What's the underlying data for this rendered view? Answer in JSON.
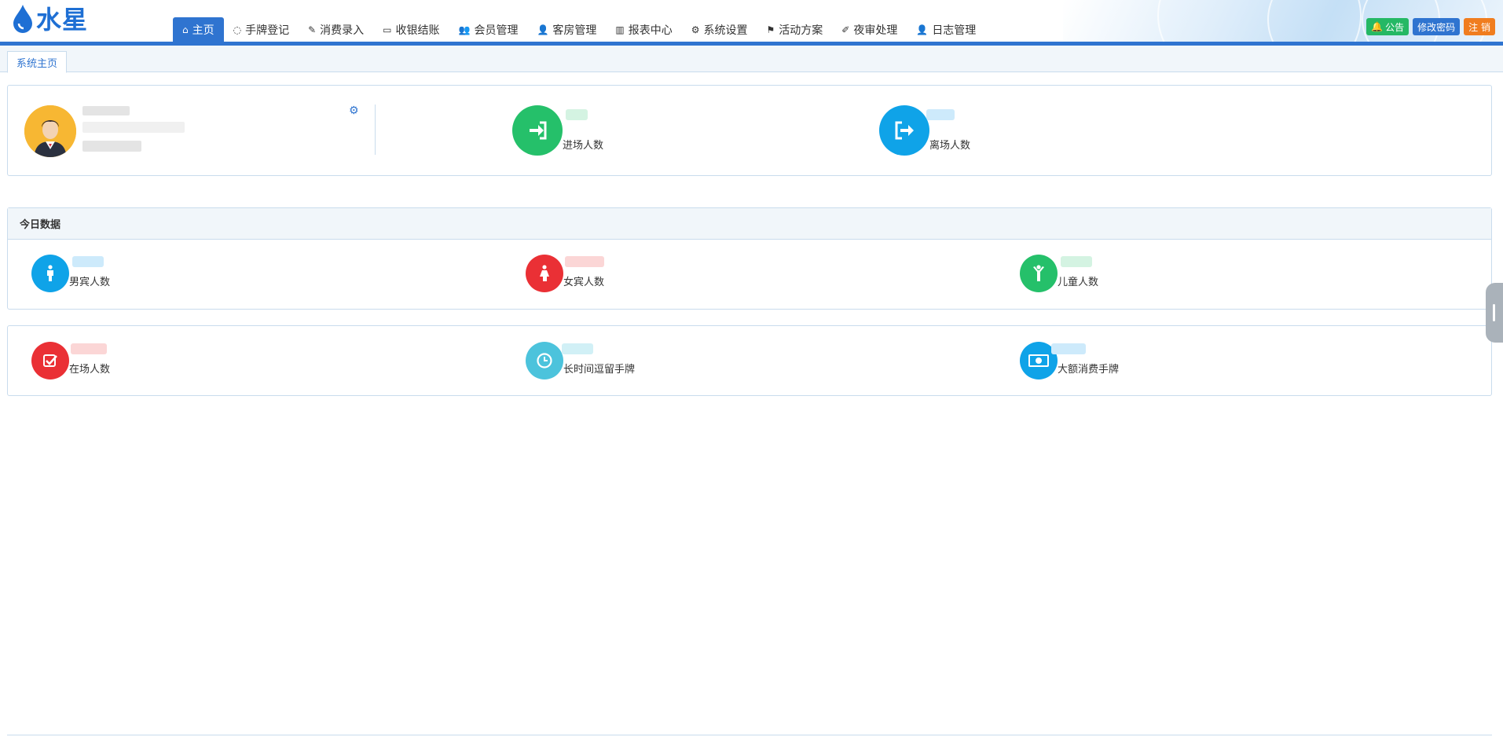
{
  "app": {
    "logo_text": "水星"
  },
  "nav": {
    "items": [
      {
        "label": "主页",
        "icon": "home-icon",
        "glyph": "⌂",
        "active": true
      },
      {
        "label": "手牌登记",
        "icon": "refresh-icon",
        "glyph": "◌"
      },
      {
        "label": "消费录入",
        "icon": "edit-icon",
        "glyph": "✎"
      },
      {
        "label": "收银结账",
        "icon": "credit-card-icon",
        "glyph": "▭"
      },
      {
        "label": "会员管理",
        "icon": "users-icon",
        "glyph": "👥"
      },
      {
        "label": "客房管理",
        "icon": "user-icon",
        "glyph": "👤"
      },
      {
        "label": "报表中心",
        "icon": "bar-chart-icon",
        "glyph": "▥"
      },
      {
        "label": "系统设置",
        "icon": "gear-icon",
        "glyph": "⚙"
      },
      {
        "label": "活动方案",
        "icon": "flag-icon",
        "glyph": "⚑"
      },
      {
        "label": "夜审处理",
        "icon": "magic-wand-icon",
        "glyph": "✐"
      },
      {
        "label": "日志管理",
        "icon": "user-icon",
        "glyph": "👤"
      }
    ]
  },
  "top_buttons": {
    "notice": "公告",
    "change_password": "修改密码",
    "logout": "注 销"
  },
  "tabs": {
    "current": "系统主页"
  },
  "profile": {
    "entry_label": "进场人数",
    "exit_label": "离场人数"
  },
  "today": {
    "title": "今日数据",
    "male_label": "男宾人数",
    "female_label": "女宾人数",
    "child_label": "儿童人数"
  },
  "status": {
    "onsite_label": "在场人数",
    "long_stay_label": "长时间逗留手牌",
    "big_spend_label": "大额消费手牌"
  },
  "colors": {
    "brand_blue": "#2f74d0",
    "green": "#25c06a",
    "sky": "#0fa3e8",
    "red": "#ea3035",
    "teal": "#4cc3dc",
    "orange": "#f07d1f"
  }
}
